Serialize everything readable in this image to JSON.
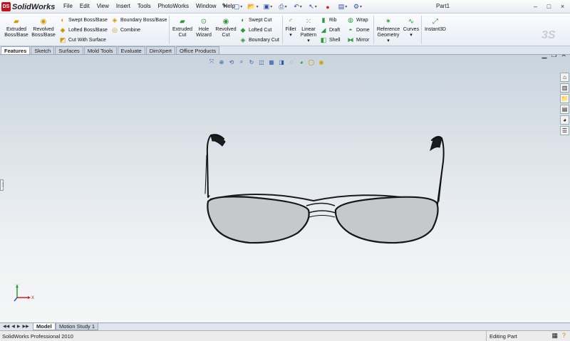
{
  "app": {
    "name": "SolidWorks",
    "logo_mark": "DS",
    "document_title": "Part1"
  },
  "menu": [
    "File",
    "Edit",
    "View",
    "Insert",
    "Tools",
    "PhotoWorks",
    "Window",
    "Help"
  ],
  "quick_access": [
    "new-document-icon",
    "open-icon",
    "save-icon",
    "print-icon",
    "undo-icon",
    "select-icon",
    "rebuild-icon",
    "file-properties-icon",
    "options-icon"
  ],
  "window_controls": [
    "–",
    "□",
    "×"
  ],
  "ribbon": {
    "extruded_boss": "Extruded\nBoss/Base",
    "revolved_boss": "Revolved\nBoss/Base",
    "swept_boss": "Swept Boss/Base",
    "lofted_boss": "Lofted Boss/Base",
    "cut_with_surface": "Cut With Surface",
    "boundary_boss": "Boundary Boss/Base",
    "combine": "Combine",
    "extruded_cut": "Extruded\nCut",
    "hole_wizard": "Hole\nWizard",
    "revolved_cut": "Revolved\nCut",
    "swept_cut": "Swept Cut",
    "lofted_cut": "Lofted Cut",
    "boundary_cut": "Boundary Cut",
    "fillet": "Fillet",
    "linear_pattern": "Linear\nPattern",
    "rib": "Rib",
    "draft": "Draft",
    "shell": "Shell",
    "wrap": "Wrap",
    "dome": "Dome",
    "mirror": "Mirror",
    "reference_geometry": "Reference\nGeometry",
    "curves": "Curves",
    "instant3d": "Instant3D"
  },
  "tabs": [
    "Features",
    "Sketch",
    "Surfaces",
    "Mold Tools",
    "Evaluate",
    "DimXpert",
    "Office Products"
  ],
  "active_tab": "Features",
  "model_tabs": [
    "Model",
    "Motion Study 1"
  ],
  "triad": {
    "x": "X",
    "y": "Y"
  },
  "status": {
    "product": "SolidWorks Professional 2010",
    "mode": "Editing Part"
  }
}
